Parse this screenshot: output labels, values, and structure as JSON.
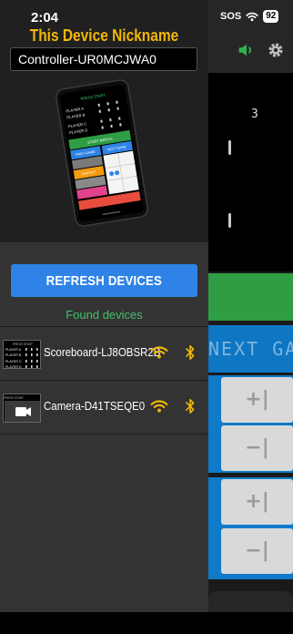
{
  "status_bar": {
    "time": "2:04",
    "sos": "SOS",
    "battery": "92"
  },
  "drawer": {
    "title": "This Device Nickname",
    "nickname_value": "Controller-UR0MCJWA0",
    "phone_preview": {
      "app_header": "PRESS START",
      "players": [
        "PLAYER A",
        "PLAYER B",
        "PLAYER C",
        "PLAYER D"
      ],
      "start_button": "START MATCH",
      "prev_button": "PREV GAME",
      "next_button": "NEXT GAME",
      "timeout_button": "TIMEOUT"
    },
    "refresh_label": "REFRESH DEVICES",
    "found_label": "Found devices",
    "devices": [
      {
        "name": "Scoreboard-LJ8OBSR2B",
        "type": "scoreboard",
        "thumb_title": "PRESS START",
        "thumb_players": [
          "PLAYER A",
          "PLAYER B",
          "PLAYER C",
          "PLAYER D"
        ]
      },
      {
        "name": "Camera-D41TSEQE0",
        "type": "camera",
        "thumb_title": "PRESS START"
      }
    ]
  },
  "background_app": {
    "score": "3",
    "banner_text": "NEXT GAME",
    "plus": "+|",
    "minus": "−|"
  },
  "colors": {
    "accent_yellow": "#f2b705",
    "refresh_blue": "#2f83e6",
    "found_green": "#40c16a",
    "app_green": "#2f9d44",
    "app_blue": "#0e77c4"
  },
  "icons": {
    "volume": "speaker-icon",
    "settings": "gear-icon",
    "wifi": "wifi-icon",
    "bluetooth": "bluetooth-icon",
    "camera": "video-camera-icon"
  }
}
